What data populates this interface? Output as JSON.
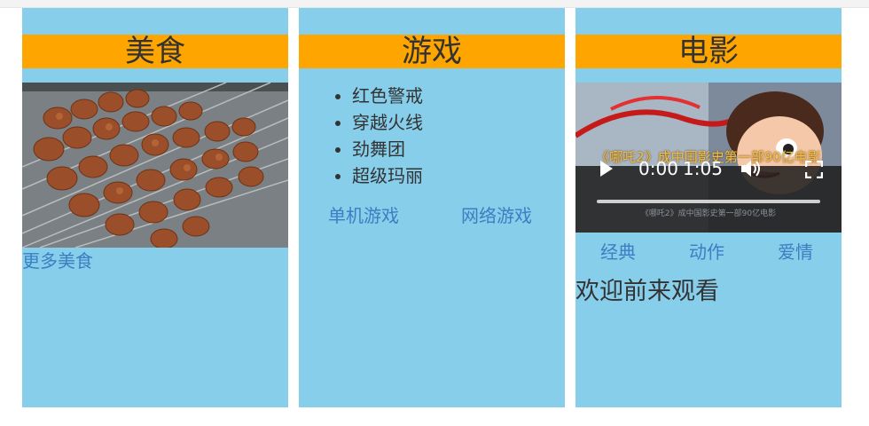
{
  "columns": {
    "food": {
      "header": "美食",
      "more_link": "更多美食"
    },
    "game": {
      "header": "游戏",
      "list": [
        "红色警戒",
        "穿越火线",
        "劲舞团",
        "超级玛丽"
      ],
      "links": [
        "单机游戏",
        "网络游戏"
      ]
    },
    "movie": {
      "header": "电影",
      "video": {
        "caption": "《哪吒2》成中国影史第一部90亿电影",
        "subcaption": "《哪吒2》成中国影史第一部90亿电影",
        "current_time": "0:00",
        "total_time": "1:05",
        "progress": 0.0
      },
      "links": [
        "经典",
        "动作",
        "爱情"
      ],
      "welcome": "欢迎前来观看"
    }
  },
  "colors": {
    "panel_bg": "#87ceeb",
    "header_bg": "#ffa500",
    "link": "#3a7fc1",
    "text": "#333333"
  },
  "icons": {
    "play": "play-icon",
    "volume": "volume-icon",
    "fullscreen": "fullscreen-icon"
  }
}
